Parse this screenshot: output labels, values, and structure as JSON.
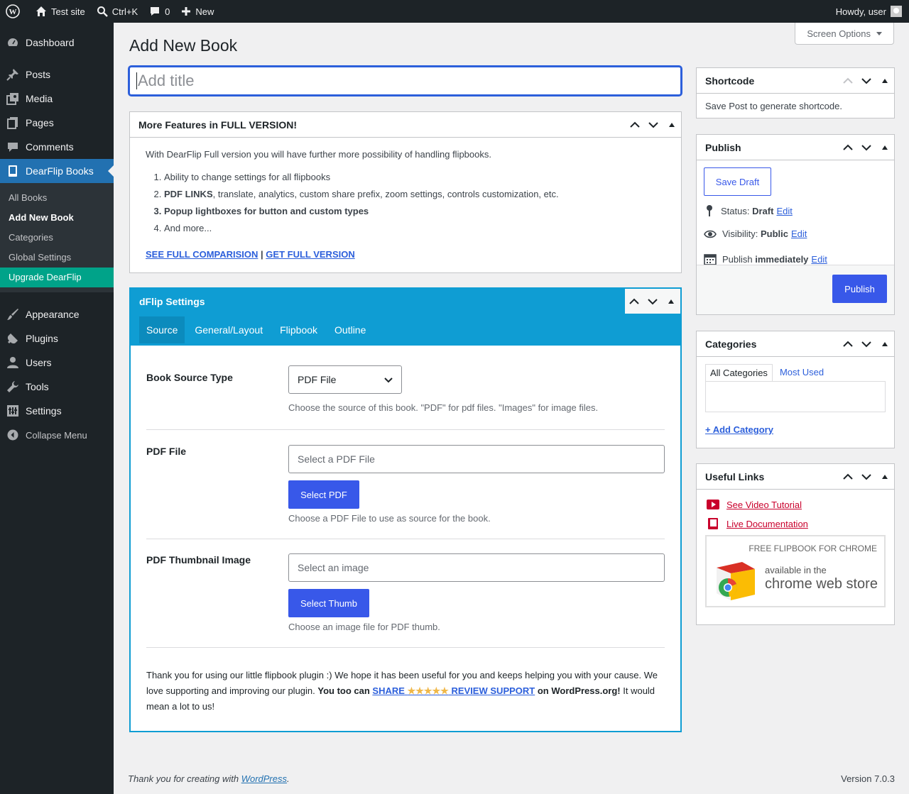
{
  "adminbar": {
    "site_name": "Test site",
    "search_shortcut": "Ctrl+K",
    "comments_count": "0",
    "new_label": "New",
    "howdy": "Howdy, user"
  },
  "sidebar": {
    "items": [
      {
        "label": "Dashboard",
        "icon": "dashboard-icon"
      },
      {
        "label": "Posts",
        "icon": "pin-icon"
      },
      {
        "label": "Media",
        "icon": "media-icon"
      },
      {
        "label": "Pages",
        "icon": "pages-icon"
      },
      {
        "label": "Comments",
        "icon": "comment-icon"
      },
      {
        "label": "DearFlip Books",
        "icon": "book-icon"
      },
      {
        "label": "Appearance",
        "icon": "brush-icon"
      },
      {
        "label": "Plugins",
        "icon": "plugin-icon"
      },
      {
        "label": "Users",
        "icon": "user-icon"
      },
      {
        "label": "Tools",
        "icon": "wrench-icon"
      },
      {
        "label": "Settings",
        "icon": "settings-icon"
      }
    ],
    "submenu": [
      "All Books",
      "Add New Book",
      "Categories",
      "Global Settings",
      "Upgrade DearFlip"
    ],
    "collapse": "Collapse Menu"
  },
  "main": {
    "screen_options": "Screen Options",
    "page_title": "Add New Book",
    "title_placeholder": "Add title"
  },
  "features": {
    "heading": "More Features in FULL VERSION!",
    "intro": "With DearFlip Full version you will have further more possibility of handling flipbooks.",
    "item1": "Ability to change settings for all flipbooks",
    "item2_bold": "PDF LINKS",
    "item2_rest": ", translate, analytics, custom share prefix, zoom settings, controls customization, etc.",
    "item3": "Popup lightboxes for button and custom types",
    "item4": "And more...",
    "link1": "SEE FULL COMPARISION",
    "separator": " | ",
    "link2": "GET FULL VERSION"
  },
  "dflip": {
    "heading": "dFlip Settings",
    "tabs": [
      "Source",
      "General/Layout",
      "Flipbook",
      "Outline"
    ],
    "source_type_label": "Book Source Type",
    "source_type_value": "PDF File",
    "source_type_desc": "Choose the source of this book. \"PDF\" for pdf files. \"Images\" for image files.",
    "pdf_label": "PDF File",
    "pdf_placeholder": "Select a PDF File",
    "pdf_button": "Select PDF",
    "pdf_desc": "Choose a PDF File to use as source for the book.",
    "thumb_label": "PDF Thumbnail Image",
    "thumb_placeholder": "Select an image",
    "thumb_button": "Select Thumb",
    "thumb_desc": "Choose an image file for PDF thumb.",
    "thanks1": "Thank you for using our little flipbook plugin :) We hope it has been useful for you and keeps helping you with your cause. We love supporting and improving our plugin. ",
    "thanks_bold1": "You too can ",
    "share": "SHARE",
    "stars": "★★★★★",
    "review": "REVIEW",
    "support": "SUPPORT",
    "thanks_bold2": " on WordPress.org!",
    "thanks2": " It would mean a lot to us!"
  },
  "shortcode": {
    "heading": "Shortcode",
    "text": "Save Post to generate shortcode."
  },
  "publish": {
    "heading": "Publish",
    "save_draft": "Save Draft",
    "status_label": "Status:",
    "status_value": "Draft",
    "visibility_label": "Visibility:",
    "visibility_value": "Public",
    "publish_label": "Publish",
    "publish_value": "immediately",
    "edit": "Edit",
    "publish_button": "Publish"
  },
  "categories": {
    "heading": "Categories",
    "tab_all": "All Categories",
    "tab_used": "Most Used",
    "add": "+ Add Category"
  },
  "useful": {
    "heading": "Useful Links",
    "video": "See Video Tutorial",
    "docs": "Live Documentation",
    "chrome_top": "FREE FLIPBOOK FOR CHROME",
    "chrome_avail": "available in the",
    "chrome_store": "chrome web store"
  },
  "footer": {
    "thanks": "Thank you for creating with ",
    "wp": "WordPress",
    "dot": ".",
    "version": "Version 7.0.3"
  },
  "colors": {
    "accent": "#2271b1",
    "dflip_blue": "#0f9dd3",
    "button_blue": "#3858e9",
    "upgrade_green": "#00a389"
  }
}
